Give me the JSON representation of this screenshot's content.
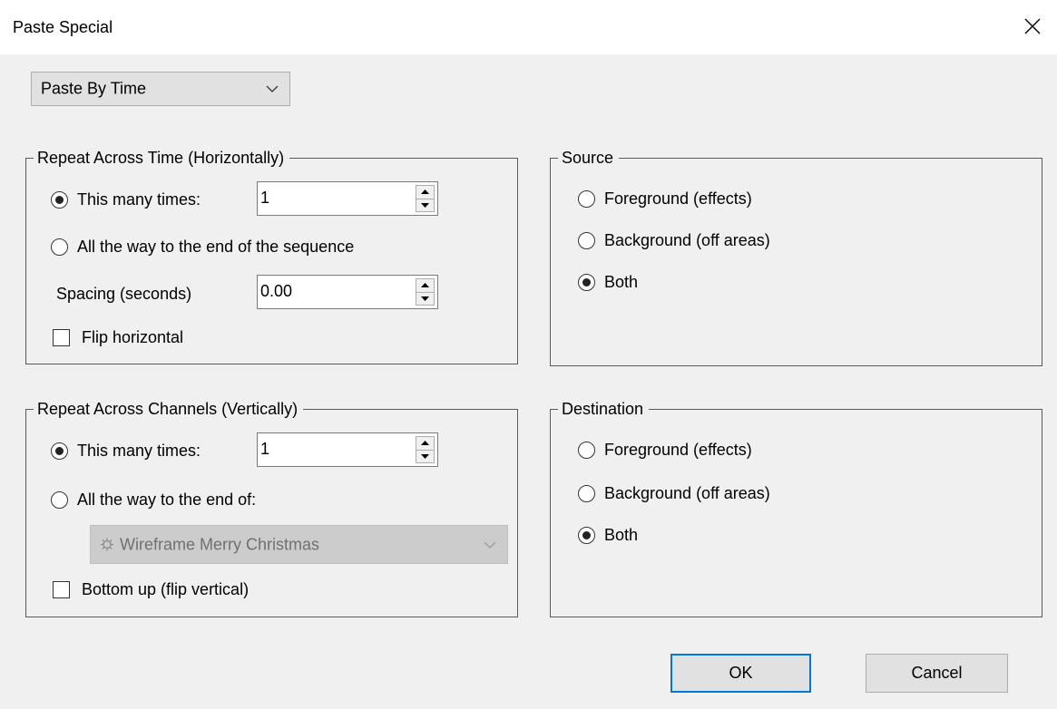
{
  "window": {
    "title": "Paste Special"
  },
  "mode": {
    "selected": "Paste By Time"
  },
  "repeat_time": {
    "legend": "Repeat Across Time (Horizontally)",
    "this_many_label": "This many times:",
    "this_many_value": "1",
    "all_the_way_label": "All the way to the end of the sequence",
    "spacing_label": "Spacing (seconds)",
    "spacing_value": "0.00",
    "flip_label": "Flip horizontal"
  },
  "repeat_channels": {
    "legend": "Repeat Across Channels (Vertically)",
    "this_many_label": "This many times:",
    "this_many_value": "1",
    "all_the_way_label": "All the way to the end of:",
    "model_selected": "Wireframe Merry Christmas",
    "model_icon": "gear-icon",
    "flip_label": "Bottom up (flip vertical)"
  },
  "source": {
    "legend": "Source",
    "options": [
      "Foreground (effects)",
      "Background (off areas)",
      "Both"
    ],
    "selected": "Both"
  },
  "destination": {
    "legend": "Destination",
    "options": [
      "Foreground (effects)",
      "Background (off areas)",
      "Both"
    ],
    "selected": "Both"
  },
  "buttons": {
    "ok": "OK",
    "cancel": "Cancel"
  },
  "colors": {
    "default_button_border": "#0078d7",
    "dialog_bg": "#f0f0f0"
  }
}
